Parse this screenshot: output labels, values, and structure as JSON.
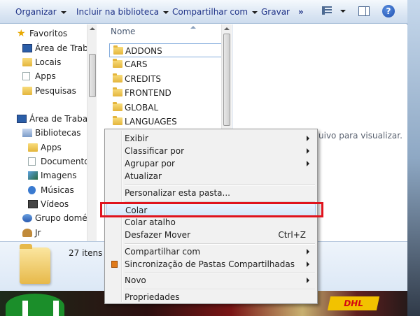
{
  "toolbar": {
    "organize": "Organizar",
    "include_library": "Incluir na biblioteca",
    "share_with": "Compartilhar com",
    "burn": "Gravar",
    "more": "»",
    "help": "?"
  },
  "nav": {
    "items": [
      {
        "label": "Favoritos",
        "icon": "star-icon"
      },
      {
        "label": "Área de Trabal",
        "icon": "desktop-icon"
      },
      {
        "label": "Locais",
        "icon": "folder-icon"
      },
      {
        "label": "Apps",
        "icon": "document-icon"
      },
      {
        "label": "Pesquisas",
        "icon": "folder-icon"
      },
      {
        "label": "Área de Trabalh",
        "icon": "desktop-icon"
      },
      {
        "label": "Bibliotecas",
        "icon": "library-icon"
      },
      {
        "label": "Apps",
        "icon": "folder-icon"
      },
      {
        "label": "Documentos",
        "icon": "document-icon"
      },
      {
        "label": "Imagens",
        "icon": "image-icon"
      },
      {
        "label": "Músicas",
        "icon": "music-icon"
      },
      {
        "label": "Vídeos",
        "icon": "video-icon"
      },
      {
        "label": "Grupo domést",
        "icon": "network-icon"
      },
      {
        "label": "Jr",
        "icon": "user-icon"
      }
    ]
  },
  "file_list": {
    "column_header": "Nome",
    "rows": [
      {
        "name": "ADDONS"
      },
      {
        "name": "CARS"
      },
      {
        "name": "CREDITS"
      },
      {
        "name": "FRONTEND"
      },
      {
        "name": "GLOBAL"
      },
      {
        "name": "LANGUAGES"
      }
    ]
  },
  "preview": {
    "message": "uivo para visualizar."
  },
  "details": {
    "item_count": "27 itens"
  },
  "context_menu": {
    "items": [
      {
        "label": "Exibir",
        "submenu": true
      },
      {
        "label": "Classificar por",
        "submenu": true
      },
      {
        "label": "Agrupar por",
        "submenu": true
      },
      {
        "label": "Atualizar"
      },
      {
        "label": "Personalizar esta pasta..."
      },
      {
        "label": "Colar"
      },
      {
        "label": "Colar atalho"
      },
      {
        "label": "Desfazer Mover",
        "shortcut": "Ctrl+Z"
      },
      {
        "label": "Compartilhar com",
        "submenu": true
      },
      {
        "label": "Sincronização de Pastas Compartilhadas",
        "submenu": true
      },
      {
        "label": "Novo",
        "submenu": true
      },
      {
        "label": "Propriedades"
      }
    ]
  },
  "desktop": {
    "dhl": "DHL"
  },
  "colors": {
    "highlight_box": "#e0141e",
    "toolbar_text": "#1e3287"
  }
}
